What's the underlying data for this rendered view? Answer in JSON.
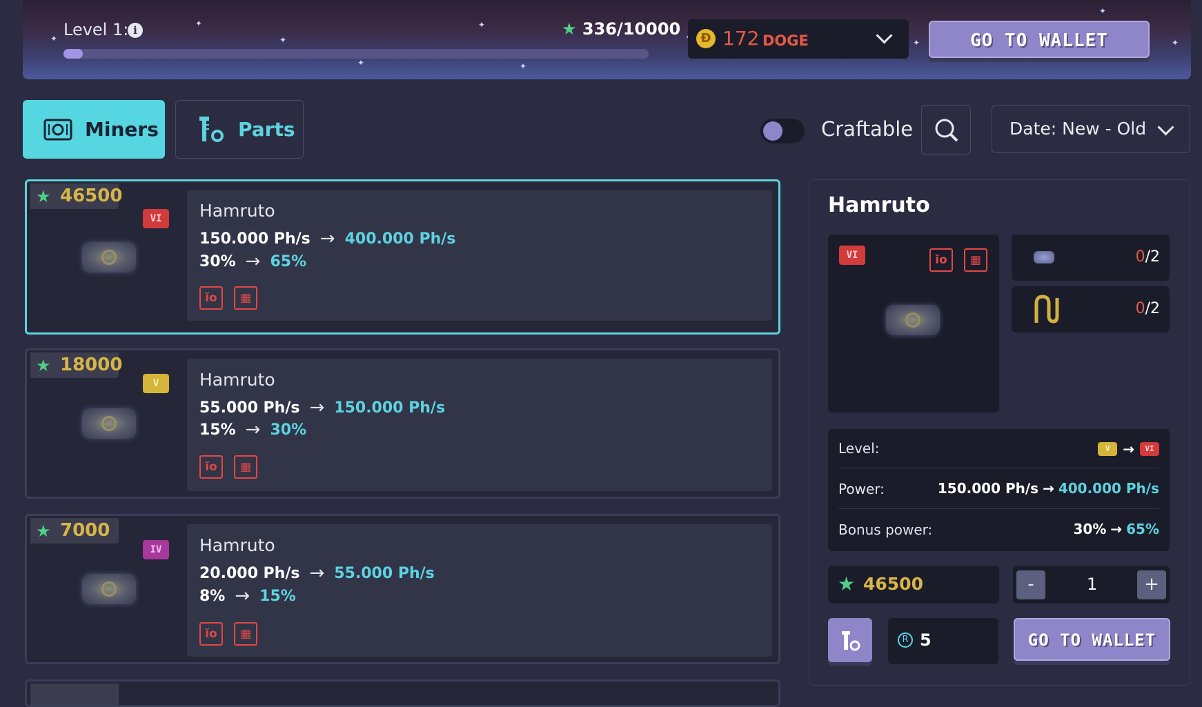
{
  "header": {
    "level_label": "Level 1:",
    "xp_text": "336/10000",
    "xp_progress": 0.0336,
    "coin_amount": "172",
    "coin_unit": "DOGE",
    "coin_symbol": "Ð",
    "wallet_button": "GO TO WALLET"
  },
  "tabs": [
    {
      "label": "Miners",
      "icon": "miner-icon",
      "active": true
    },
    {
      "label": "Parts",
      "icon": "parts-icon",
      "active": false
    }
  ],
  "filters": {
    "craftable_label": "Craftable",
    "craftable_on": false,
    "sort_label": "Date: New - Old"
  },
  "miners": [
    {
      "price": "46500",
      "tier": "VI",
      "tier_color": "#d23b3b",
      "name": "Hamruto",
      "power_from": "150.000 Ph/s",
      "power_to": "400.000 Ph/s",
      "bonus_from": "30%",
      "bonus_to": "65%",
      "selected": true
    },
    {
      "price": "18000",
      "tier": "V",
      "tier_color": "#d4b43a",
      "name": "Hamruto",
      "power_from": "55.000 Ph/s",
      "power_to": "150.000 Ph/s",
      "bonus_from": "15%",
      "bonus_to": "30%",
      "selected": false
    },
    {
      "price": "7000",
      "tier": "IV",
      "tier_color": "#a8399c",
      "name": "Hamruto",
      "power_from": "20.000 Ph/s",
      "power_to": "55.000 Ph/s",
      "bonus_from": "8%",
      "bonus_to": "15%",
      "selected": false
    }
  ],
  "detail": {
    "title": "Hamruto",
    "tier": "VI",
    "slots": [
      {
        "icon": "miner-part-icon",
        "have": "0",
        "need": "/2"
      },
      {
        "icon": "cable-icon",
        "have": "0",
        "need": "/2"
      }
    ],
    "level_label": "Level:",
    "level_from": "V",
    "level_to": "VI",
    "power_label": "Power:",
    "power_from": "150.000 Ph/s",
    "power_to": "400.000 Ph/s",
    "bonus_label": "Bonus power:",
    "bonus_from": "30%",
    "bonus_to": "65%",
    "price": "46500",
    "quantity": "1",
    "minus_label": "-",
    "plus_label": "+",
    "parts_cost": "5",
    "parts_currency_symbol": "R",
    "wallet_button": "GO TO WALLET"
  },
  "colors": {
    "accent": "#5dd3e0",
    "danger": "#e55a45",
    "gold": "#d8b548",
    "star": "#4fd08a",
    "button": "#8e86c8"
  }
}
